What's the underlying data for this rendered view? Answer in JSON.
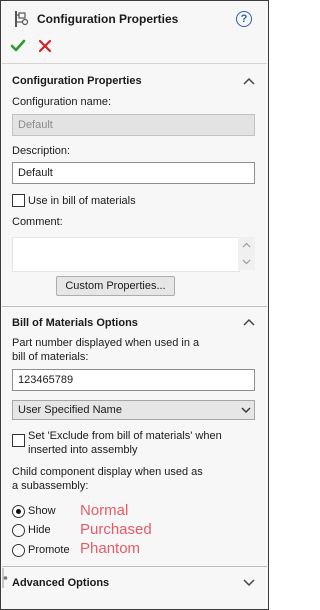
{
  "header": {
    "title": "Configuration Properties",
    "help_glyph": "?",
    "icons": [
      "configuration-icon",
      "help-icon",
      "ok-checkmark-icon",
      "cancel-x-icon"
    ],
    "colors": {
      "ok": "#2e9a2e",
      "cancel": "#d0202a",
      "help": "#2a5ea8"
    }
  },
  "config_section": {
    "header": "Configuration Properties",
    "name_label": "Configuration name:",
    "name_value": "Default",
    "description_label": "Description:",
    "description_value": "Default",
    "use_in_bom_label": "Use in bill of materials",
    "use_in_bom_checked": false,
    "comment_label": "Comment:",
    "comment_value": "",
    "custom_properties_button": "Custom Properties..."
  },
  "bom_section": {
    "header": "Bill of Materials Options",
    "part_number_label_line1": "Part number displayed when used in a",
    "part_number_label_line2": "bill of materials:",
    "part_number_value": "123465789",
    "name_source_selected": "User Specified Name",
    "exclude_label_line1": "Set 'Exclude from bill of materials' when",
    "exclude_label_line2": "inserted into assembly",
    "exclude_checked": false,
    "child_display_label_line1": "Child component display when used as",
    "child_display_label_line2": "a subassembly:",
    "options": [
      {
        "label": "Show",
        "selected": true,
        "note": "Normal"
      },
      {
        "label": "Hide",
        "selected": false,
        "note": "Purchased"
      },
      {
        "label": "Promote",
        "selected": false,
        "note": "Phantom"
      }
    ],
    "note_color": "#e85b66"
  },
  "advanced_section": {
    "header": "Advanced Options"
  }
}
